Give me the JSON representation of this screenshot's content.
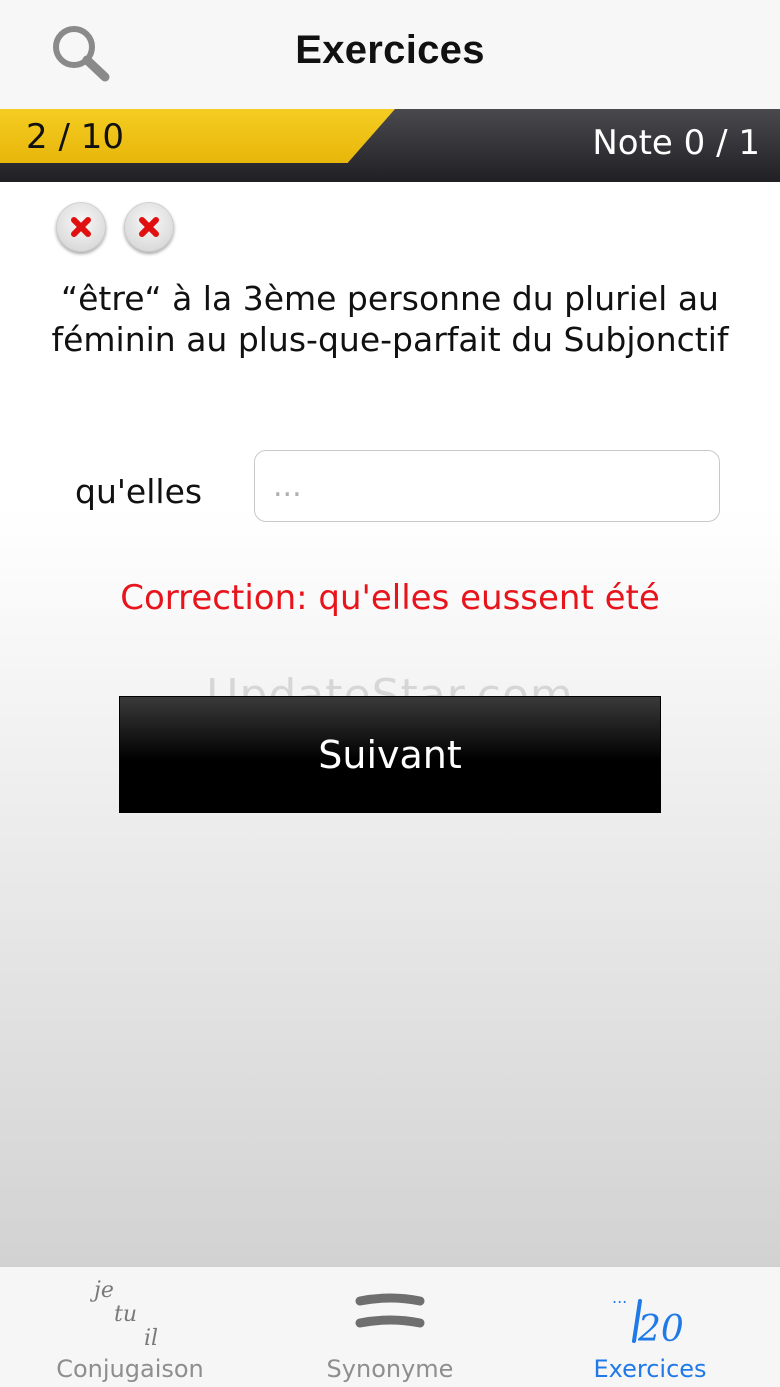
{
  "header": {
    "title": "Exercices",
    "search_icon": "search-icon"
  },
  "progress": {
    "label": "2 / 10",
    "current": 2,
    "total": 10,
    "score_label": "Note 0 / 1",
    "accent_color": "#f2c417"
  },
  "attempts": [
    {
      "result": "wrong",
      "icon": "wrong-mark-icon"
    },
    {
      "result": "wrong",
      "icon": "wrong-mark-icon"
    }
  ],
  "question": {
    "text": "“être“ à la 3ème personne du pluriel au féminin au plus-que-parfait du Subjonctif"
  },
  "answer": {
    "pronoun": "qu'elles",
    "value": "",
    "placeholder": "..."
  },
  "correction": {
    "text": "Correction: qu'elles eussent été",
    "color": "#e8141b"
  },
  "watermark": "UpdateStar.com",
  "next_button": {
    "label": "Suivant"
  },
  "tabbar": {
    "tabs": [
      {
        "label": "Conjugaison",
        "icon": "conjugation-icon",
        "icon_text": [
          "je",
          "tu",
          "il"
        ],
        "active": false
      },
      {
        "label": "Synonyme",
        "icon": "equals-icon",
        "active": false
      },
      {
        "label": "Exercices",
        "icon": "score-icon",
        "icon_text": "20",
        "active": true
      }
    ],
    "active_color": "#1f7ae8"
  }
}
